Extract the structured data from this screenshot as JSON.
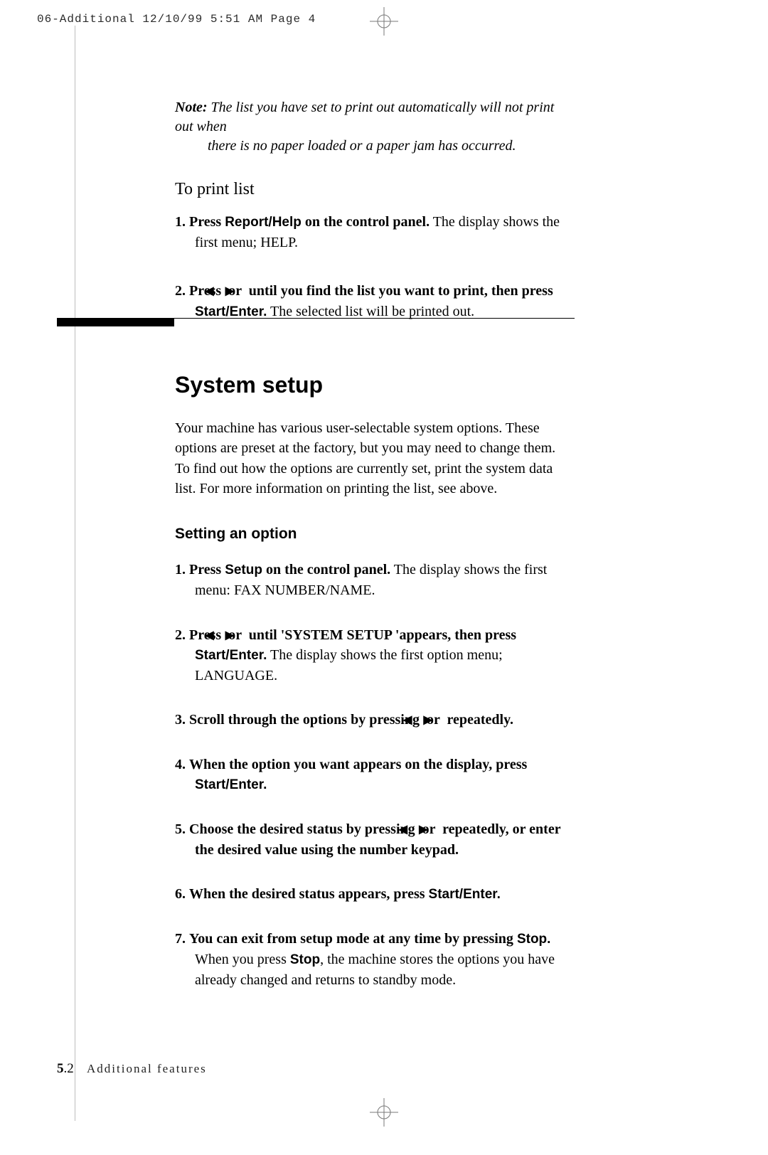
{
  "slug": "06-Additional  12/10/99 5:51 AM  Page 4",
  "note": {
    "label": "Note:",
    "line1": "The list you have set to print out automatically will not print out when",
    "line2": "there is no paper loaded or a paper jam has occurred."
  },
  "printlist": {
    "heading": "To print list",
    "step1_num": "1.",
    "step1_a": "Press ",
    "step1_b": "Report/Help",
    "step1_c": " on the control panel.",
    "step1_tail": "  The display shows the first menu; HELP.",
    "step2_num": "2.",
    "step2_a": "Press ",
    "step2_b": " or ",
    "step2_c": " until you find the list you want to print, then press ",
    "step2_d": "Start/Enter.",
    "step2_tail": " The selected list will be printed out."
  },
  "tri_left": "◀",
  "tri_right": "▶",
  "system": {
    "title": "System setup",
    "intro": "Your machine has various user-selectable system options. These options are preset at the factory, but you may need to change them. To find out how the options are currently set, print the system data list. For more information on printing the list, see above.",
    "subhead": "Setting an option",
    "s1_num": "1.",
    "s1_a": "Press ",
    "s1_b": "Setup",
    "s1_c": " on the control panel.",
    "s1_tail": " The display shows the first menu: FAX NUMBER/NAME.",
    "s2_num": "2.",
    "s2_a": "Press ",
    "s2_b": " or ",
    "s2_c": " until 'SYSTEM SETUP 'appears, then press ",
    "s2_d": "Start/Enter.",
    "s2_tail": " The display shows the first option menu;  LANGUAGE.",
    "s3_num": "3.",
    "s3_a": "Scroll through the options by pressing ",
    "s3_b": " or ",
    "s3_c": " repeatedly.",
    "s4_num": "4.",
    "s4_a": "When the option you want appears on the display,  press ",
    "s4_b": "Start/Enter.",
    "s5_num": "5.",
    "s5_a": "Choose the desired status by pressing ",
    "s5_b": " or ",
    "s5_c": " repeatedly, or enter the desired value using the number keypad.",
    "s6_num": "6.",
    "s6_a": "When the desired status appears, press ",
    "s6_b": "Start/Enter.",
    "s7_num": "7.",
    "s7_a": "You can exit from setup mode at any time by pressing ",
    "s7_b": "Stop.",
    "s7_tail1": " When you press ",
    "s7_tail2": "Stop",
    "s7_tail3": ", the machine stores the options you have already changed and returns to standby mode."
  },
  "footer": {
    "chapter": "5",
    "dot": ".",
    "page": "2",
    "section": "Additional features"
  }
}
